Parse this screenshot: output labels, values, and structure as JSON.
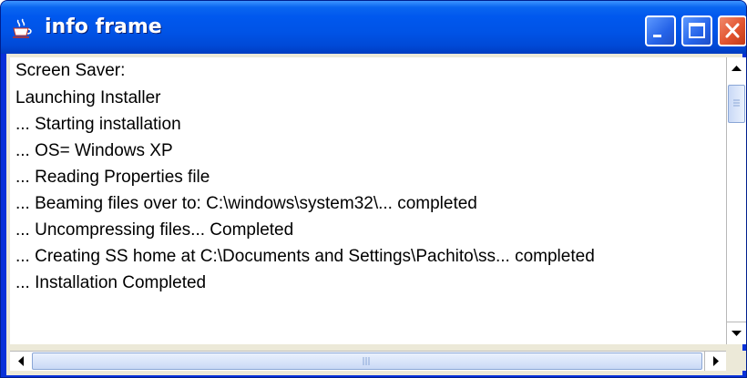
{
  "window": {
    "title": "info frame",
    "icon": "java-coffee-cup-icon"
  },
  "title_buttons": {
    "minimize_icon": "minimize-icon",
    "maximize_icon": "maximize-icon",
    "close_icon": "close-icon"
  },
  "log": {
    "lines": [
      "Screen Saver:",
      "Launching Installer",
      "... Starting installation",
      "... OS= Windows XP",
      "... Reading Properties file",
      "... Beaming files over to: C:\\windows\\system32\\... completed",
      "... Uncompressing files... Completed",
      "... Creating SS home at C:\\Documents and Settings\\Pachito\\ss... completed",
      "... Installation Completed"
    ]
  },
  "colors": {
    "titlebar": "#0058ee",
    "close_button": "#e2542f",
    "scroll_thumb": "#c9d9f6"
  }
}
